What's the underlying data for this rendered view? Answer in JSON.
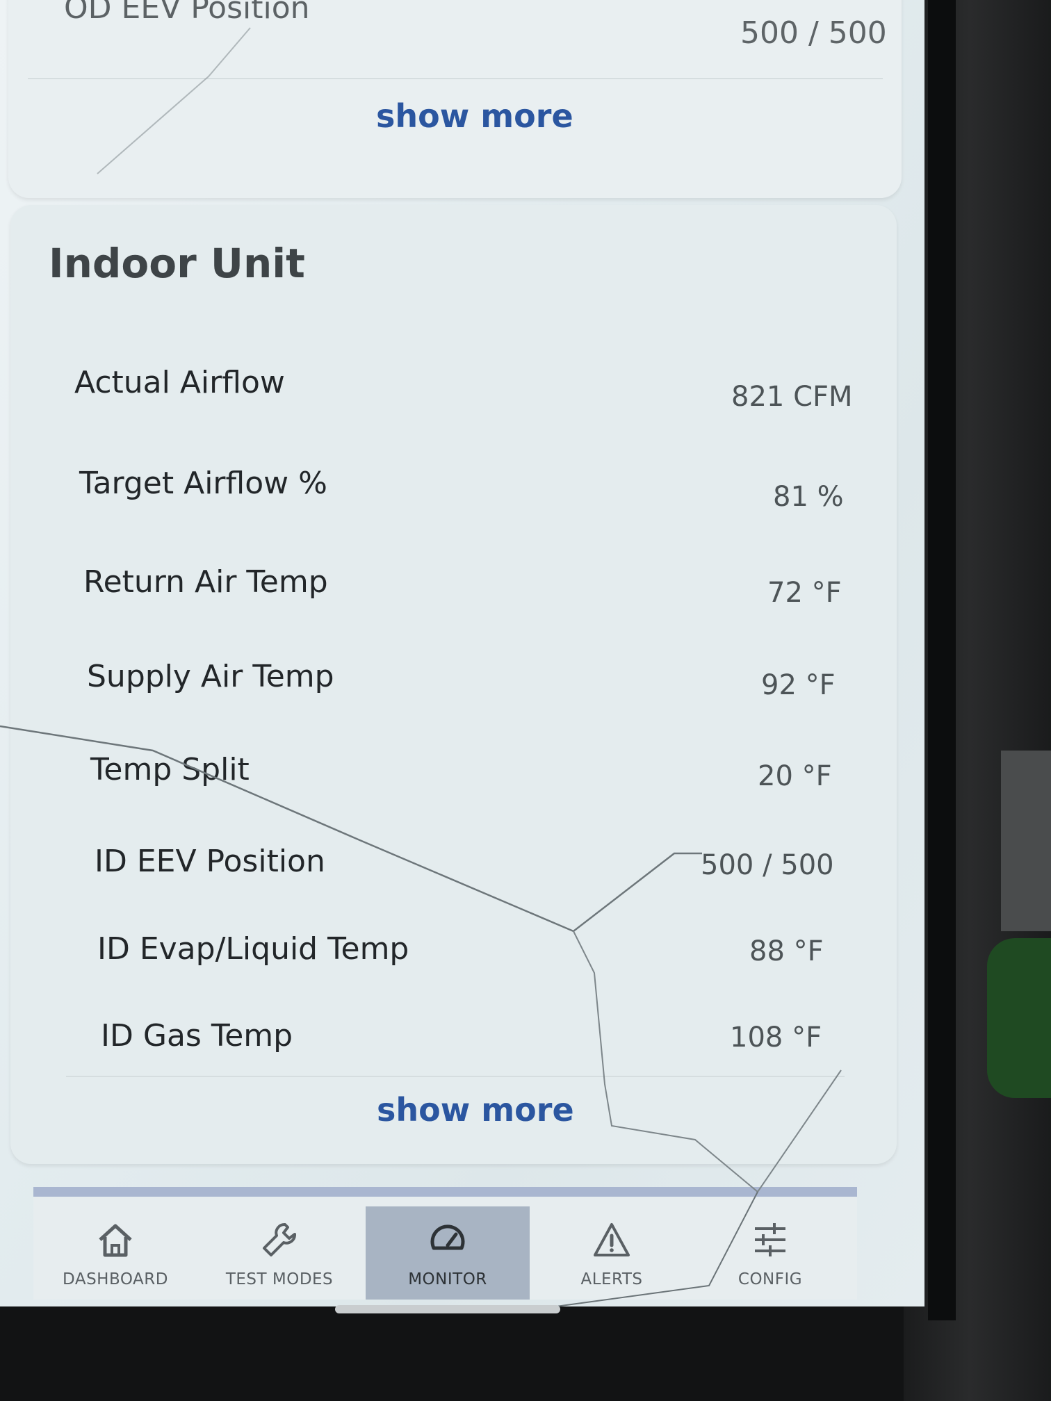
{
  "top_card": {
    "row_label": "OD EEV Position",
    "row_value": "500 / 500",
    "show_more": "show more"
  },
  "indoor_unit": {
    "title": "Indoor Unit",
    "rows": [
      {
        "label": "Actual Airflow",
        "value": "821 CFM"
      },
      {
        "label": "Target Airflow %",
        "value": "81 %"
      },
      {
        "label": "Return Air Temp",
        "value": "72 °F"
      },
      {
        "label": "Supply Air Temp",
        "value": "92 °F"
      },
      {
        "label": "Temp Split",
        "value": "20 °F"
      },
      {
        "label": "ID EEV Position",
        "value": "500 / 500"
      },
      {
        "label": "ID Evap/Liquid Temp",
        "value": "88 °F"
      },
      {
        "label": "ID Gas Temp",
        "value": "108 °F"
      }
    ],
    "show_more": "show more"
  },
  "bottom_nav": {
    "items": [
      {
        "label": "DASHBOARD",
        "icon": "home-icon",
        "active": false
      },
      {
        "label": "TEST MODES",
        "icon": "wrench-icon",
        "active": false
      },
      {
        "label": "MONITOR",
        "icon": "gauge-icon",
        "active": true
      },
      {
        "label": "ALERTS",
        "icon": "warning-icon",
        "active": false
      },
      {
        "label": "CONFIG",
        "icon": "sliders-icon",
        "active": false
      }
    ]
  },
  "colors": {
    "accent_link": "#2b56a0",
    "nav_active_bg": "#a8b4c3",
    "nav_top_border": "#a9b6d0"
  }
}
